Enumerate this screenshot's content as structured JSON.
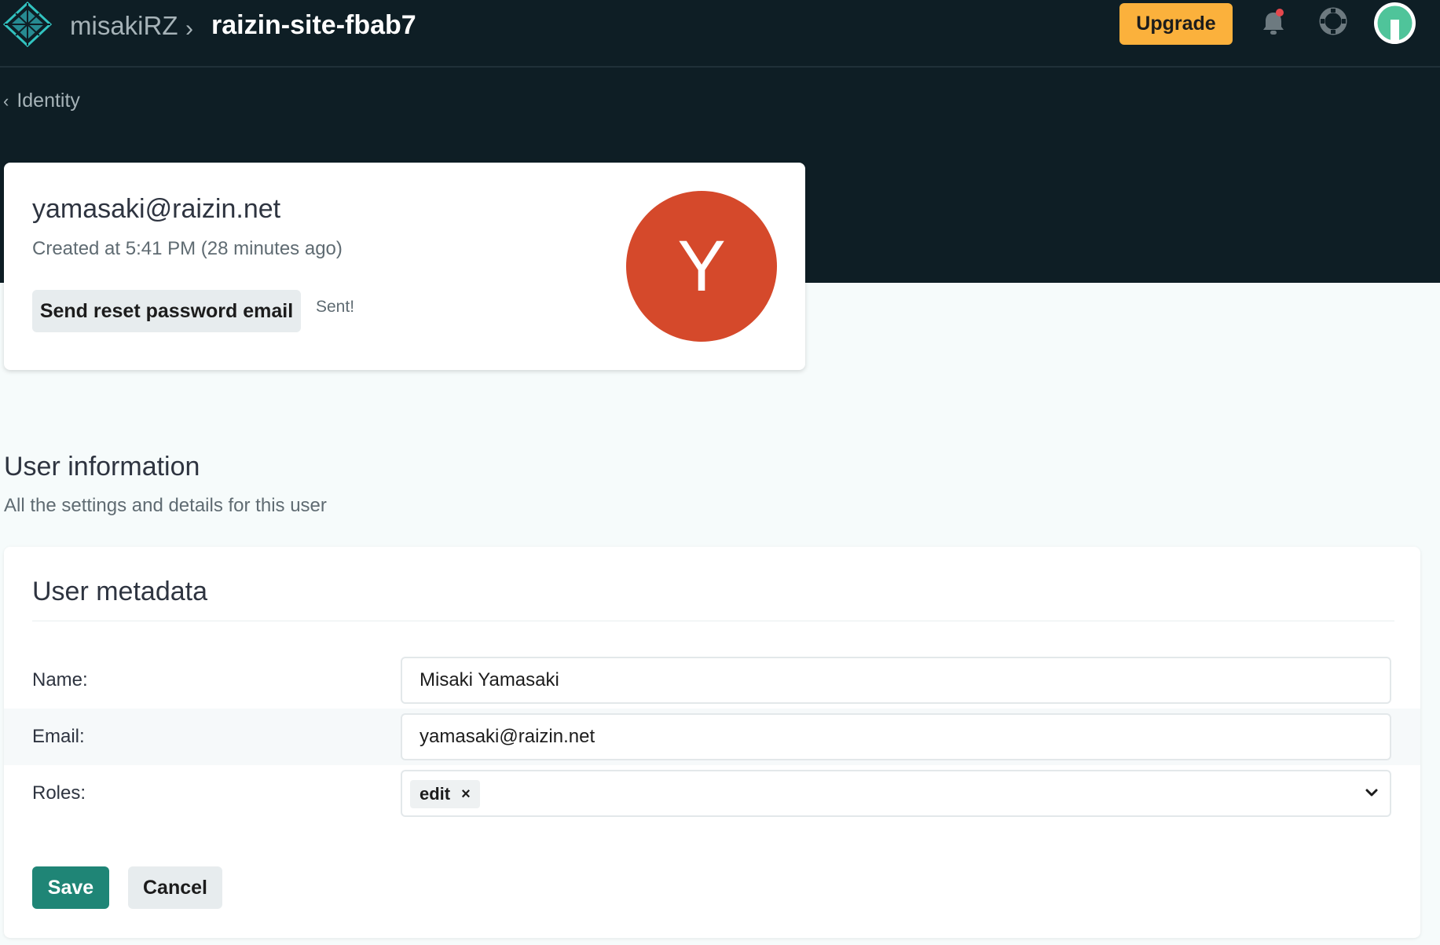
{
  "header": {
    "team_name": "misakiRZ",
    "separator": "›",
    "site_name": "raizin-site-fbab7",
    "upgrade_label": "Upgrade",
    "notification_dot_color": "#e5484d"
  },
  "breadcrumb": {
    "back_label": "Identity"
  },
  "user_card": {
    "email": "yamasaki@raizin.net",
    "created": "Created at 5:41 PM (28 minutes ago)",
    "reset_button_label": "Send reset password email",
    "status_text": "Sent!",
    "avatar_initial": "Y",
    "avatar_color": "#d5492b"
  },
  "section": {
    "title": "User information",
    "subtitle": "All the settings and details for this user"
  },
  "metadata": {
    "title": "User metadata",
    "name_label": "Name:",
    "name_value": "Misaki Yamasaki",
    "email_label": "Email:",
    "email_value": "yamasaki@raizin.net",
    "roles_label": "Roles:",
    "roles": [
      "edit"
    ],
    "remove_role_symbol": "×",
    "save_label": "Save",
    "cancel_label": "Cancel"
  },
  "colors": {
    "dark_background": "#0e1e25",
    "accent_teal": "#1f8576",
    "upgrade_orange": "#fbb13c"
  }
}
